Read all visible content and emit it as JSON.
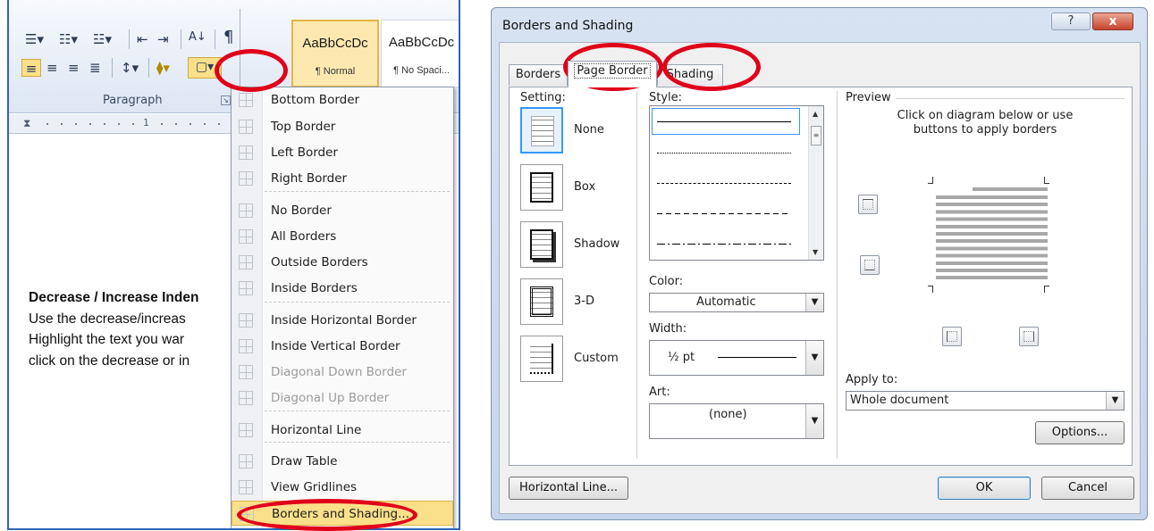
{
  "ribbon": {
    "group_label": "Paragraph",
    "styles": [
      {
        "sample": "AaBbCcDc",
        "name": "¶ Normal"
      },
      {
        "sample": "AaBbCcDc",
        "name": "¶ No Spaci..."
      }
    ],
    "pilcrow": "¶",
    "ruler_mark": "1"
  },
  "document": {
    "heading": "Decrease / Increase Inden",
    "lines": [
      "Use the decrease/increas",
      "Highlight the text you war",
      "click on the decrease or in"
    ]
  },
  "border_menu": {
    "items": [
      {
        "label": "Bottom Border",
        "icon": "bottom-border-icon",
        "disabled": false
      },
      {
        "label": "Top Border",
        "icon": "top-border-icon",
        "disabled": false
      },
      {
        "label": "Left Border",
        "icon": "left-border-icon",
        "disabled": false
      },
      {
        "label": "Right Border",
        "icon": "right-border-icon",
        "disabled": false
      },
      {
        "label": "No Border",
        "icon": "no-border-icon",
        "disabled": false
      },
      {
        "label": "All Borders",
        "icon": "all-borders-icon",
        "disabled": false
      },
      {
        "label": "Outside Borders",
        "icon": "outside-borders-icon",
        "disabled": false
      },
      {
        "label": "Inside Borders",
        "icon": "inside-borders-icon",
        "disabled": false
      },
      {
        "label": "Inside Horizontal Border",
        "icon": "inside-horizontal-border-icon",
        "disabled": false
      },
      {
        "label": "Inside Vertical Border",
        "icon": "inside-vertical-border-icon",
        "disabled": false
      },
      {
        "label": "Diagonal Down Border",
        "icon": "diagonal-down-border-icon",
        "disabled": true
      },
      {
        "label": "Diagonal Up Border",
        "icon": "diagonal-up-border-icon",
        "disabled": true
      },
      {
        "label": "Horizontal Line",
        "icon": "horizontal-line-icon",
        "disabled": false
      },
      {
        "label": "Draw Table",
        "icon": "draw-table-icon",
        "disabled": false
      },
      {
        "label": "View Gridlines",
        "icon": "view-gridlines-icon",
        "disabled": false
      },
      {
        "label": "Borders and Shading...",
        "icon": "borders-shading-icon",
        "disabled": false
      }
    ]
  },
  "dialog": {
    "title": "Borders and Shading",
    "help": "?",
    "close": "x",
    "tabs": [
      "Borders",
      "Page Border",
      "Shading"
    ],
    "active_tab": "Page Border",
    "setting_label": "Setting:",
    "settings": [
      "None",
      "Box",
      "Shadow",
      "3-D",
      "Custom"
    ],
    "selected_setting": "None",
    "style_label": "Style:",
    "color_label": "Color:",
    "color_value": "Automatic",
    "width_label": "Width:",
    "width_value": "½ pt",
    "art_label": "Art:",
    "art_value": "(none)",
    "preview_label": "Preview",
    "preview_hint": "Click on diagram below or use buttons to apply borders",
    "apply_label": "Apply to:",
    "apply_value": "Whole document",
    "options_button": "Options...",
    "horizontal_line_button": "Horizontal Line...",
    "ok_button": "OK",
    "cancel_button": "Cancel"
  },
  "colors": {
    "annotation_ring": "#e0001a",
    "highlight": "#fbe08a",
    "selection_blue": "#3399ff",
    "window_frame": "#c5d6ec"
  }
}
